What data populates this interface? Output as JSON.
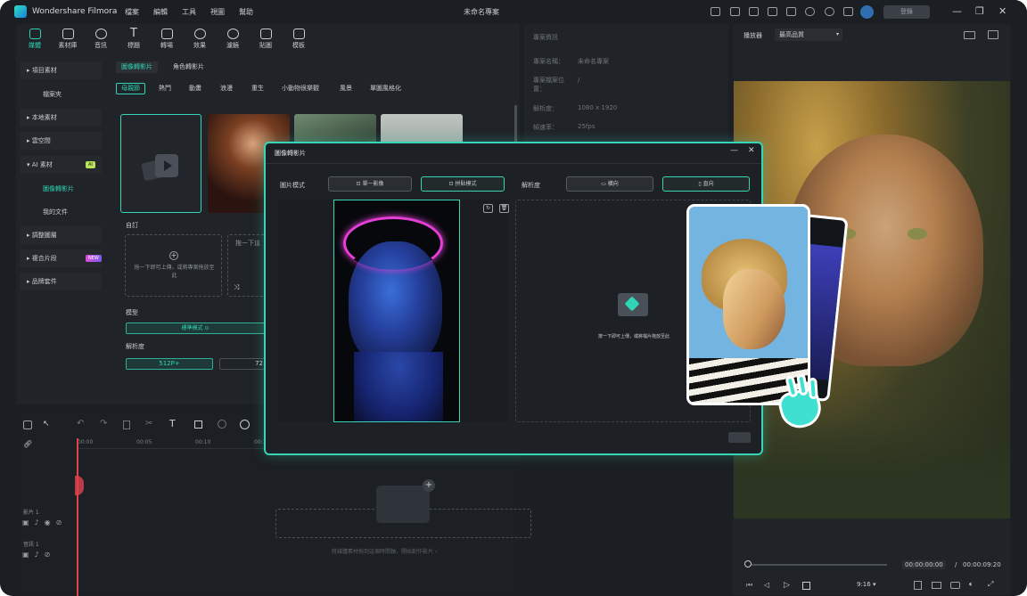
{
  "app": {
    "name": "Wondershare Filmora",
    "title": "未命名專案",
    "login_label": "登錄"
  },
  "menu": [
    "檔案",
    "編輯",
    "工具",
    "視圖",
    "幫助"
  ],
  "toolbar": [
    "媒體",
    "素材庫",
    "音訊",
    "標題",
    "轉場",
    "效果",
    "濾鏡",
    "貼圖",
    "模板"
  ],
  "sidebar": {
    "items": [
      "項目素材",
      "本地素材",
      "雲空間",
      "AI 素材",
      "調整圖層",
      "複合片段",
      "品牌套件"
    ],
    "subs": [
      "檔案夾",
      "圖像轉影片",
      "我的文件"
    ],
    "ai_badge": "AI",
    "new_badge": "NEW"
  },
  "media_tabs": [
    "圖像轉影片",
    "角色轉影片"
  ],
  "categories": [
    "母親節",
    "熱門",
    "動畫",
    "浪漫",
    "重生",
    "小動物很樂觀",
    "風景",
    "單圖風格化"
  ],
  "custom": {
    "heading": "自訂",
    "upload_text": "拖一下即可上傳，或將專案拖放至此",
    "upload_text2": "拖一下這",
    "model_label": "模型",
    "model_value": "標準模式",
    "res_label": "解析度",
    "res_value": "512P+",
    "res_value2": "72"
  },
  "project_info": {
    "heading": "專案資訊",
    "rows": [
      {
        "label": "專案名稱：",
        "value": "未命名專案"
      },
      {
        "label": "專案檔案位置：",
        "value": "/"
      },
      {
        "label": "解析度：",
        "value": "1080 x 1920"
      },
      {
        "label": "幀速率：",
        "value": "25fps"
      }
    ]
  },
  "player": {
    "label": "播放器",
    "quality": "最高品質",
    "time_current": "00:00:00:00",
    "time_sep": "/",
    "time_total": "00:00:09:20",
    "ratio": "9:16"
  },
  "dialog": {
    "title": "圖像轉影片",
    "image_mode_label": "圖片模式",
    "mode_single": "單一影像",
    "mode_collage": "拼貼模式",
    "resolution_label": "解析度",
    "res_horizontal": "橫向",
    "res_vertical": "直向",
    "drop_text": "按一下即可上傳，或將檔片拖放至此"
  },
  "timeline": {
    "ticks": [
      "00:00",
      "00:05",
      "00:10",
      "00:15"
    ],
    "tracks": [
      "影片 1",
      "音訊 1"
    ],
    "empty_hint": "將媒體素材拖到這個時間軸，開始創作影片 ›"
  },
  "colors": {
    "accent": "#37d4b8",
    "brand": "#2fd5b5",
    "playhead": "#e0424d"
  }
}
